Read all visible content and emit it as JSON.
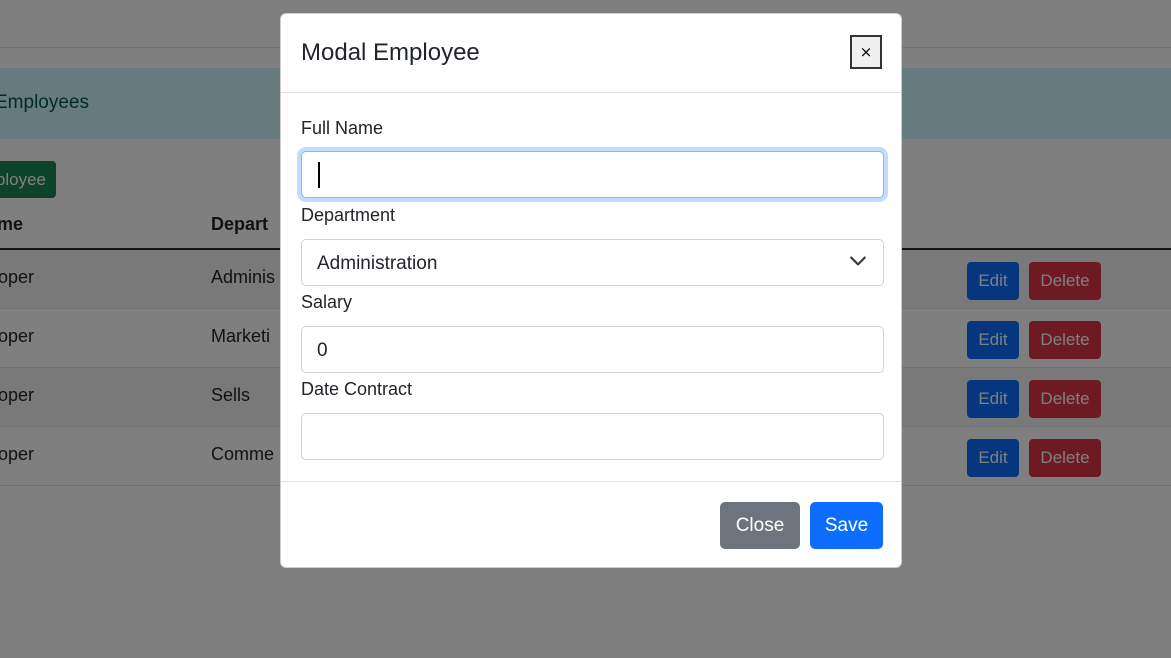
{
  "background": {
    "brand": "/",
    "banner_title": "Employees",
    "add_button": "ployee",
    "table": {
      "headers": [
        "me",
        "Depart"
      ],
      "rows": [
        {
          "name": "oper",
          "department": "Adminis"
        },
        {
          "name": "oper",
          "department": "Marketi"
        },
        {
          "name": "oper",
          "department": "Sells"
        },
        {
          "name": "oper",
          "department": "Comme"
        }
      ],
      "edit_label": "Edit",
      "delete_label": "Delete"
    }
  },
  "modal": {
    "title": "Modal Employee",
    "close_x": "×",
    "fields": {
      "full_name": {
        "label": "Full Name",
        "value": ""
      },
      "department": {
        "label": "Department",
        "selected": "Administration"
      },
      "salary": {
        "label": "Salary",
        "value": "0"
      },
      "date_contract": {
        "label": "Date Contract",
        "value": ""
      }
    },
    "footer": {
      "close_label": "Close",
      "save_label": "Save"
    }
  },
  "colors": {
    "primary": "#0d6efd",
    "secondary": "#6c757d",
    "success": "#198754",
    "danger": "#dc3545",
    "info_bg": "#cff4fc"
  }
}
